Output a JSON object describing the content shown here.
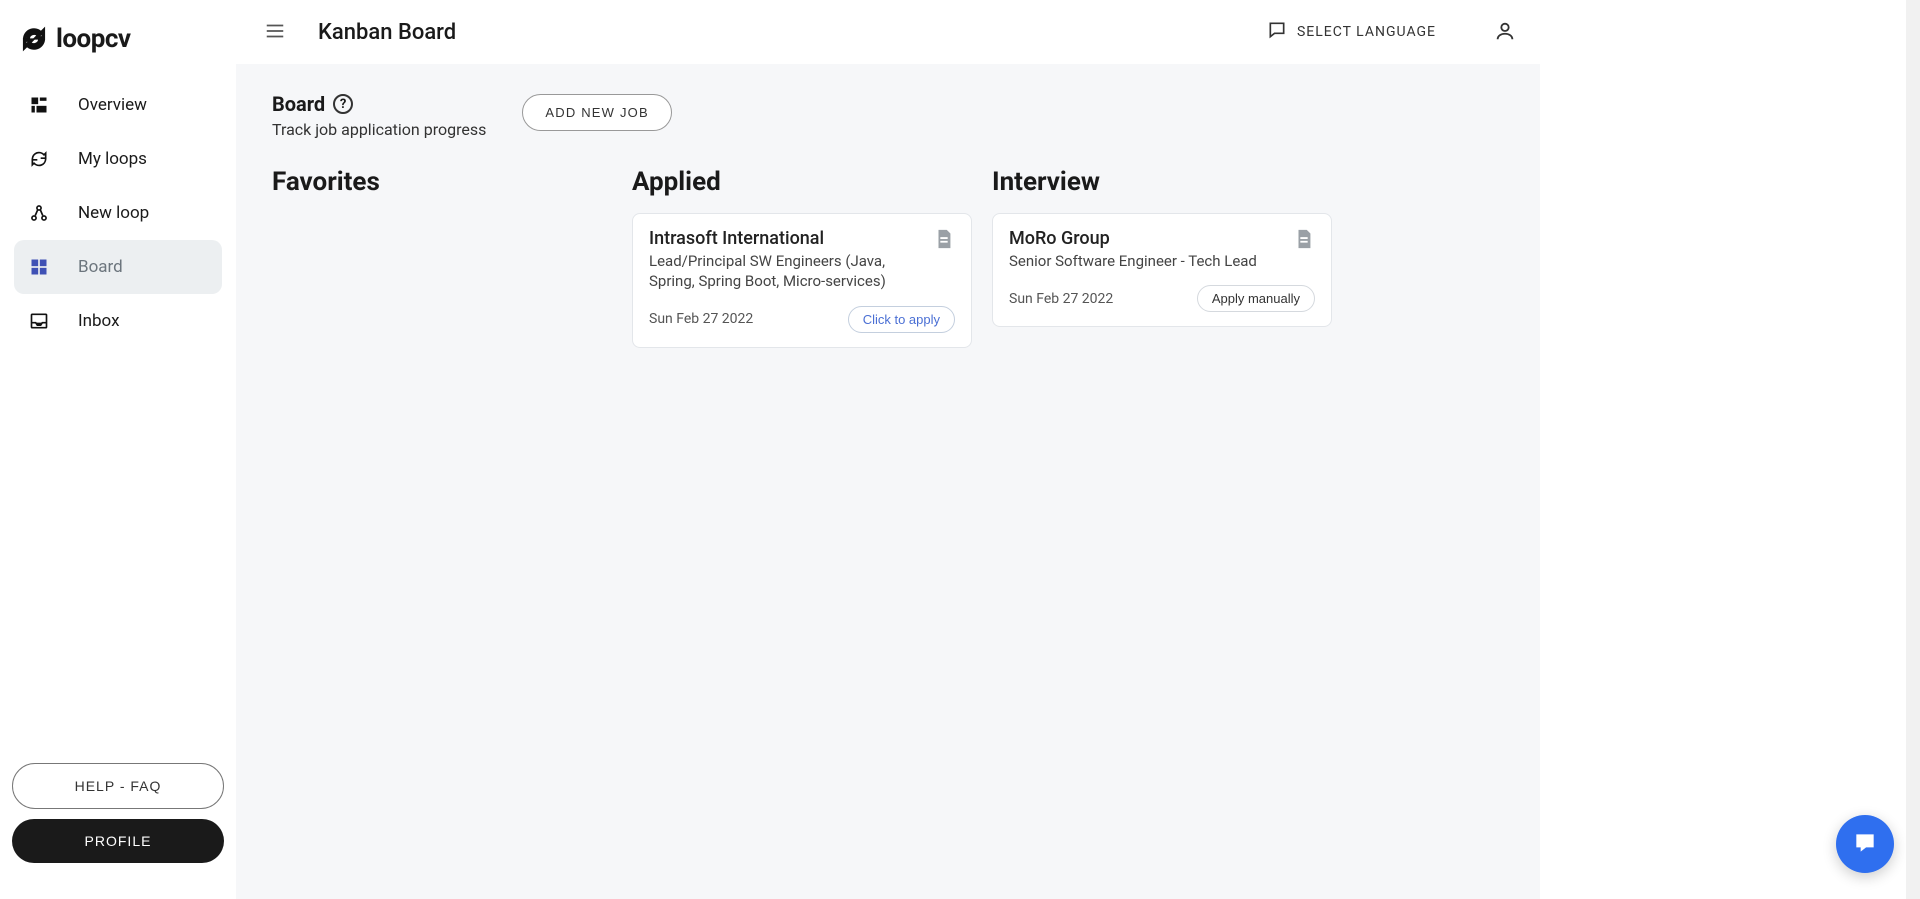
{
  "brand": "loopcv",
  "header": {
    "title": "Kanban Board",
    "language_label": "SELECT LANGUAGE"
  },
  "sidebar": {
    "items": [
      {
        "label": "Overview"
      },
      {
        "label": "My loops"
      },
      {
        "label": "New loop"
      },
      {
        "label": "Board"
      },
      {
        "label": "Inbox"
      }
    ],
    "help_label": "HELP - FAQ",
    "profile_label": "PROFILE"
  },
  "board": {
    "title": "Board",
    "subtitle": "Track job application progress",
    "add_label": "ADD NEW JOB"
  },
  "columns": {
    "favorites": {
      "title": "Favorites"
    },
    "applied": {
      "title": "Applied",
      "cards": [
        {
          "company": "Intrasoft International",
          "role": "Lead/Principal SW Engineers (Java, Spring, Spring Boot, Micro-services)",
          "date": "Sun Feb 27 2022",
          "action": "Click to apply"
        }
      ]
    },
    "interview": {
      "title": "Interview",
      "cards": [
        {
          "company": "MoRo Group",
          "role": "Senior Software Engineer - Tech Lead",
          "date": "Sun Feb 27 2022",
          "action": "Apply manually"
        }
      ]
    }
  }
}
